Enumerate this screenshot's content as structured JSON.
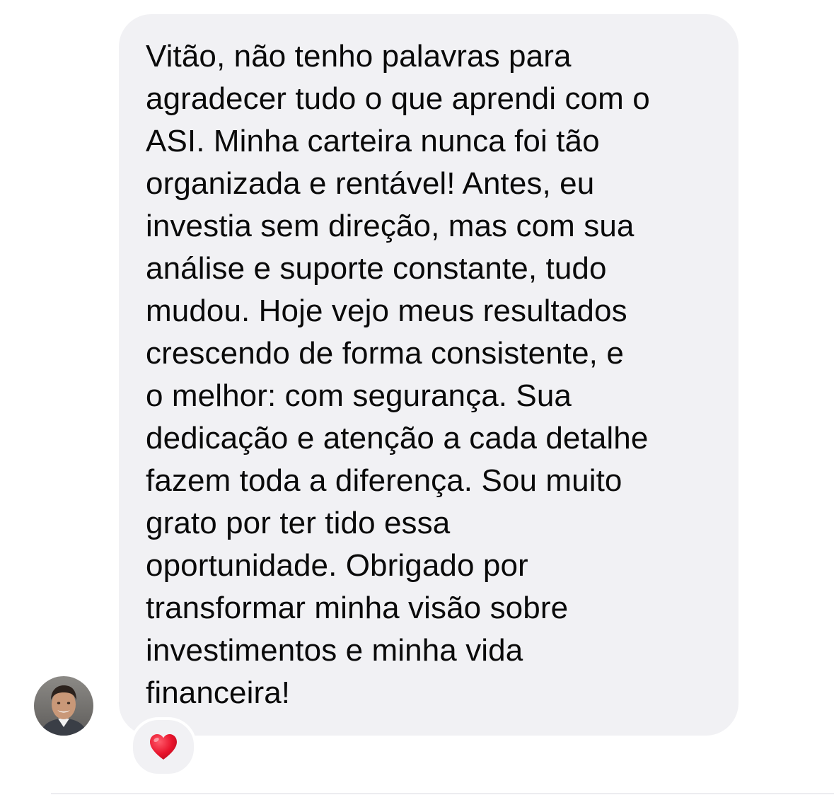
{
  "message": {
    "lines": [
      "Vitão, não tenho palavras para",
      "agradecer tudo o que aprendi com o",
      "ASI. Minha carteira nunca foi tão",
      "organizada e rentável! Antes, eu",
      "investia sem direção, mas com sua",
      "análise e suporte constante, tudo",
      "mudou. Hoje vejo meus resultados",
      "crescendo de forma consistente, e",
      "o melhor: com segurança. Sua",
      "dedicação e atenção a cada detalhe",
      "fazem toda a diferença. Sou muito",
      "grato por ter tido essa",
      "oportunidade. Obrigado por",
      "transformar minha visão sobre",
      "investimentos e minha vida",
      "financeira!"
    ],
    "bubble_color": "#f1f1f4",
    "text_color": "#0a0a0a"
  },
  "sender": {
    "avatar_icon": "person-avatar-icon"
  },
  "reaction": {
    "icon": "red-heart-icon",
    "color": "#e8132b"
  }
}
